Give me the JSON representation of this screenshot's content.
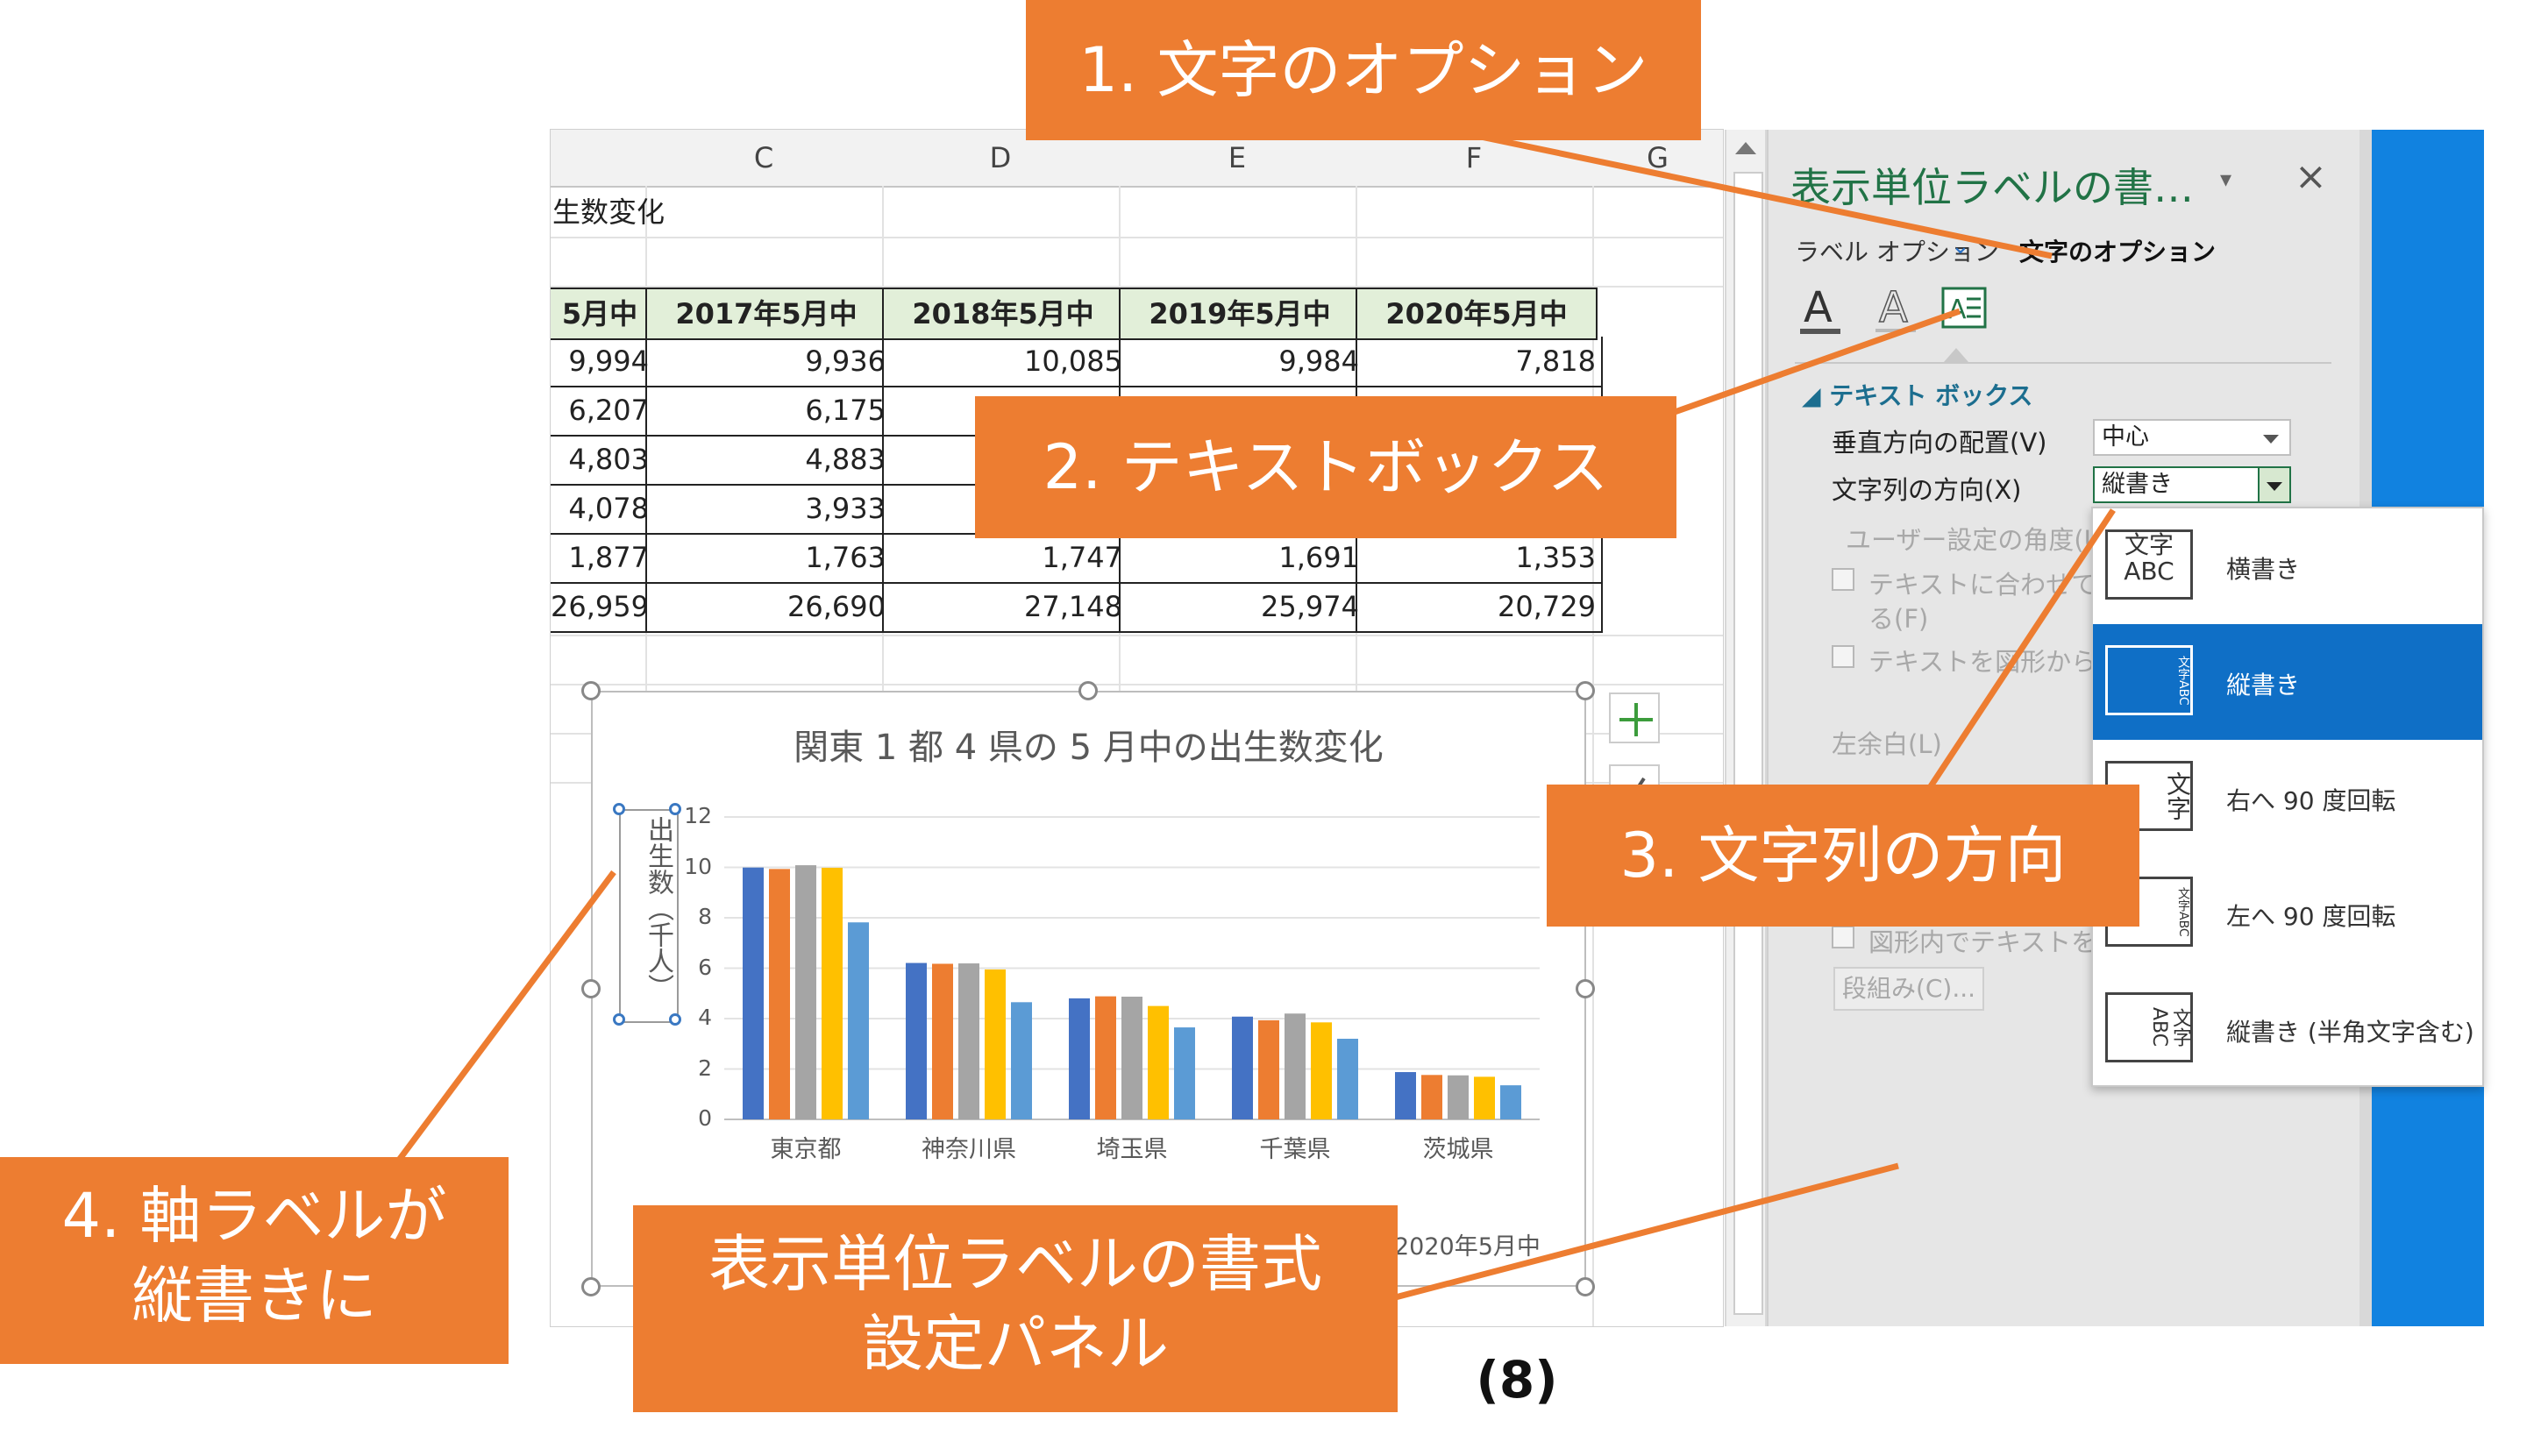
{
  "sheet": {
    "columns": [
      "C",
      "D",
      "E",
      "F",
      "G"
    ],
    "title_fragment": "生数変化",
    "table_headers": [
      "5月中",
      "2017年5月中",
      "2018年5月中",
      "2019年5月中",
      "2020年5月中"
    ],
    "table_rows": [
      [
        "9,994",
        "9,936",
        "10,085",
        "9,984",
        "7,818"
      ],
      [
        "6,207",
        "6,175",
        "",
        "",
        ""
      ],
      [
        "4,803",
        "4,883",
        "",
        "",
        ""
      ],
      [
        "4,078",
        "3,933",
        "",
        "",
        ""
      ],
      [
        "1,877",
        "1,763",
        "1,747",
        "1,691",
        "1,353"
      ],
      [
        "26,959",
        "26,690",
        "27,148",
        "25,974",
        "20,729"
      ]
    ]
  },
  "chart": {
    "title": "関東 1 都 4 県の 5 月中の出生数変化",
    "axis_label": "出生数（千人）",
    "cut_legend": "2020年5月中"
  },
  "chart_data": {
    "type": "bar",
    "title": "関東 1 都 4 県の 5 月中の出生数変化",
    "ylabel": "出生数（千人）",
    "categories": [
      "東京都",
      "神奈川県",
      "埼玉県",
      "千葉県",
      "茨城県"
    ],
    "yticks": [
      "0",
      "2",
      "4",
      "6",
      "8",
      "10",
      "12"
    ],
    "ylim": [
      0,
      12
    ],
    "series": [
      {
        "values": [
          9.994,
          6.207,
          4.803,
          4.078,
          1.877
        ],
        "color": "#4472c4"
      },
      {
        "values": [
          9.936,
          6.175,
          4.883,
          3.933,
          1.763
        ],
        "color": "#ed7d31"
      },
      {
        "values": [
          10.085,
          6.19,
          4.87,
          4.2,
          1.747
        ],
        "color": "#a5a5a5"
      },
      {
        "values": [
          9.984,
          5.95,
          4.5,
          3.85,
          1.691
        ],
        "color": "#ffc000"
      },
      {
        "values": [
          7.818,
          4.65,
          3.65,
          3.2,
          1.353
        ],
        "color": "#5b9bd5"
      }
    ],
    "grid": true
  },
  "pane": {
    "title": "表示単位ラベルの書…",
    "label_options": "ラベル オプション",
    "text_options": "文字のオプション",
    "section": "テキスト ボックス",
    "vertical_align_label": "垂直方向の配置(V)",
    "vertical_align_value": "中心",
    "text_direction_label": "文字列の方向(X)",
    "text_direction_value": "縦書き",
    "custom_angle_label": "ユーザー設定の角度(U)",
    "resize_shape_label": "テキストに合わせて図形",
    "resize_shape_label2": "る(F)",
    "allow_overflow_label": "テキストを図形からはみ",
    "left_margin_label": "左余白(L)",
    "wrap_text_label": "図形内でテキストを折り",
    "columns_button": "段組み(C)..."
  },
  "dropdown": [
    {
      "icon_text": "文字 ABC",
      "label": "横書き",
      "selected": false
    },
    {
      "icon_text": "文字ABC",
      "label": "縦書き",
      "selected": true
    },
    {
      "icon_text": "文字",
      "label": "右へ 90 度回転",
      "selected": false
    },
    {
      "icon_text": "文字ABC",
      "label": "左へ 90 度回転",
      "selected": false
    },
    {
      "icon_text": "文字ABC",
      "label": "縦書き (半角文字含む)",
      "selected": false
    }
  ],
  "callouts": {
    "c1": "1. 文字のオプション",
    "c2": "2. テキストボックス",
    "c3": "3. 文字列の方向",
    "c4_line1": "4. 軸ラベルが",
    "c4_line2": "縦書きに",
    "c5_line1": "表示単位ラベルの書式",
    "c5_line2": "設定パネル"
  },
  "figure_number": "(8)",
  "colors": {
    "accent": "#ed7d31",
    "excel_green": "#217346",
    "selection_blue": "#0f6fc6"
  }
}
